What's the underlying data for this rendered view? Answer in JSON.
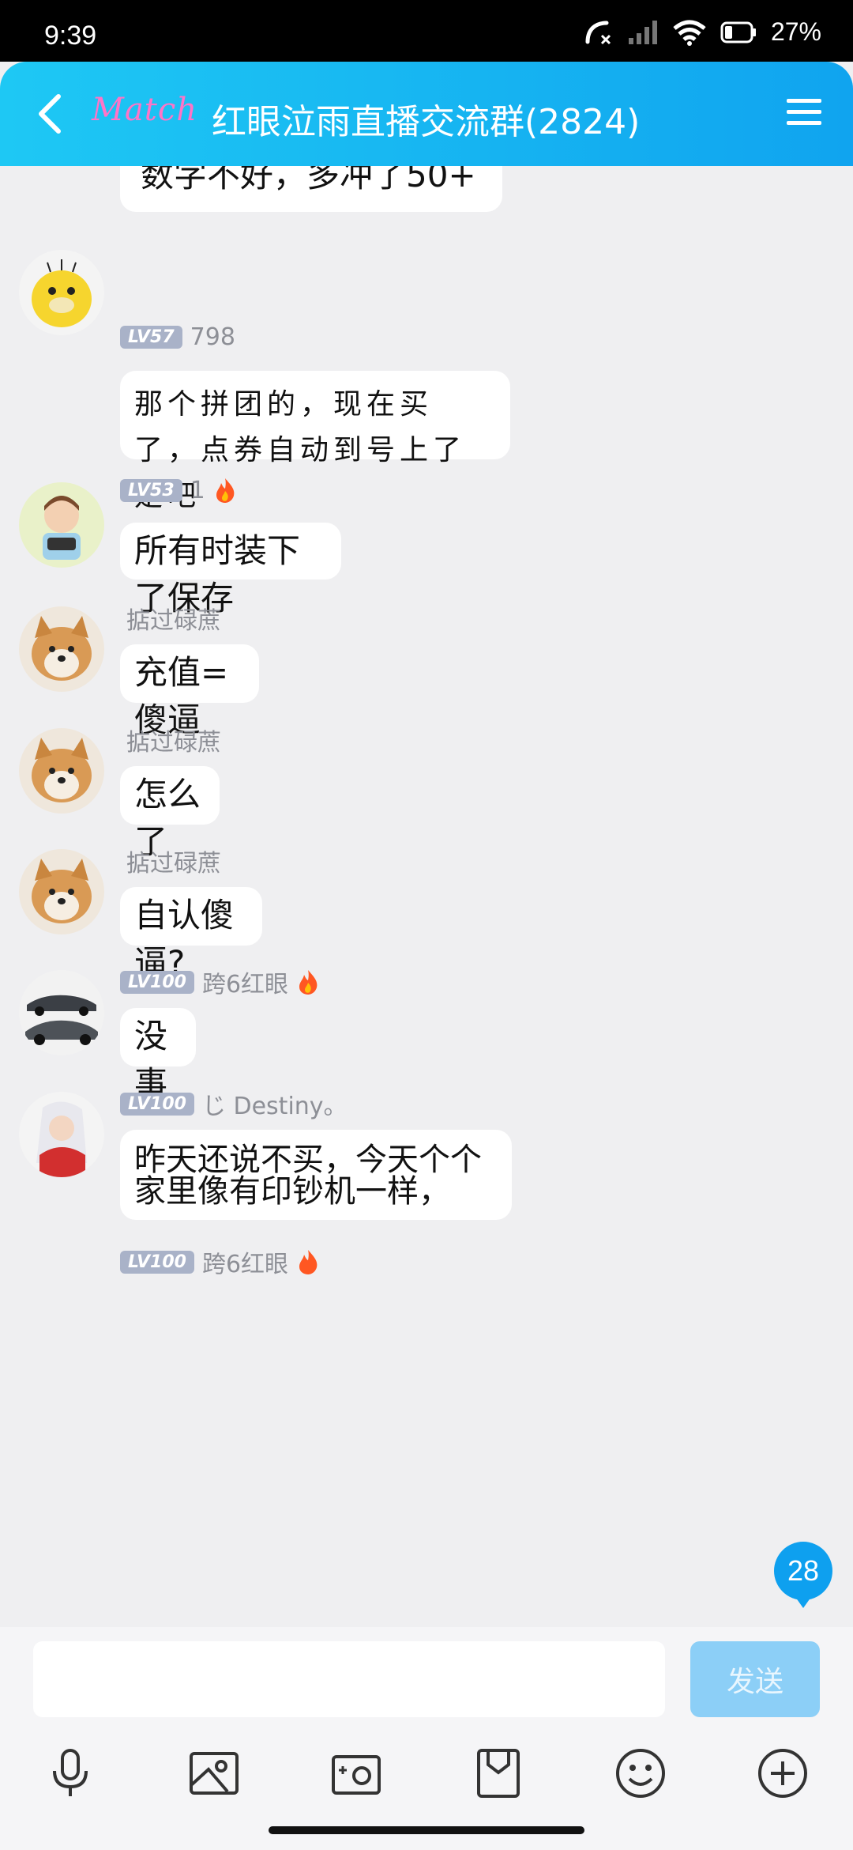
{
  "status": {
    "time": "9:39",
    "battery": "27%"
  },
  "header": {
    "brand": "Match",
    "title": "红眼泣雨直播交流群(2824)"
  },
  "messages": {
    "m0": {
      "text": "数字不好，多冲了50+"
    },
    "m1": {
      "level": "LV57",
      "name": "798",
      "text": "那个拼团的，现在买了，点券自动到号上了是吧"
    },
    "m2": {
      "level": "LV53",
      "name": "1",
      "text": "所有时装下了保存"
    },
    "m3": {
      "name": "掂过碌蔗",
      "text": "充值=傻逼"
    },
    "m4": {
      "name": "掂过碌蔗",
      "text": "怎么了"
    },
    "m5": {
      "name": "掂过碌蔗",
      "text": "自认傻逼?"
    },
    "m6": {
      "level": "LV100",
      "name": "跨6红眼",
      "text": "没事"
    },
    "m7": {
      "level": "LV100",
      "name": "じ Destiny。",
      "text": "昨天还说不买，今天个个家里像有印钞机一样，"
    },
    "m8": {
      "level": "LV100",
      "name": "跨6红眼"
    }
  },
  "unread_count": "28",
  "composer": {
    "send_label": "发送",
    "input_value": ""
  },
  "icons": [
    "back-arrow-icon",
    "menu-icon",
    "microphone-icon",
    "image-icon",
    "camera-icon",
    "file-icon",
    "emoji-icon",
    "plus-icon",
    "fire-icon"
  ],
  "colors": {
    "header_start": "#1ec8f4",
    "header_end": "#10a4ef",
    "accent": "#0ea0ef",
    "send_disabled": "#8ccff7"
  }
}
